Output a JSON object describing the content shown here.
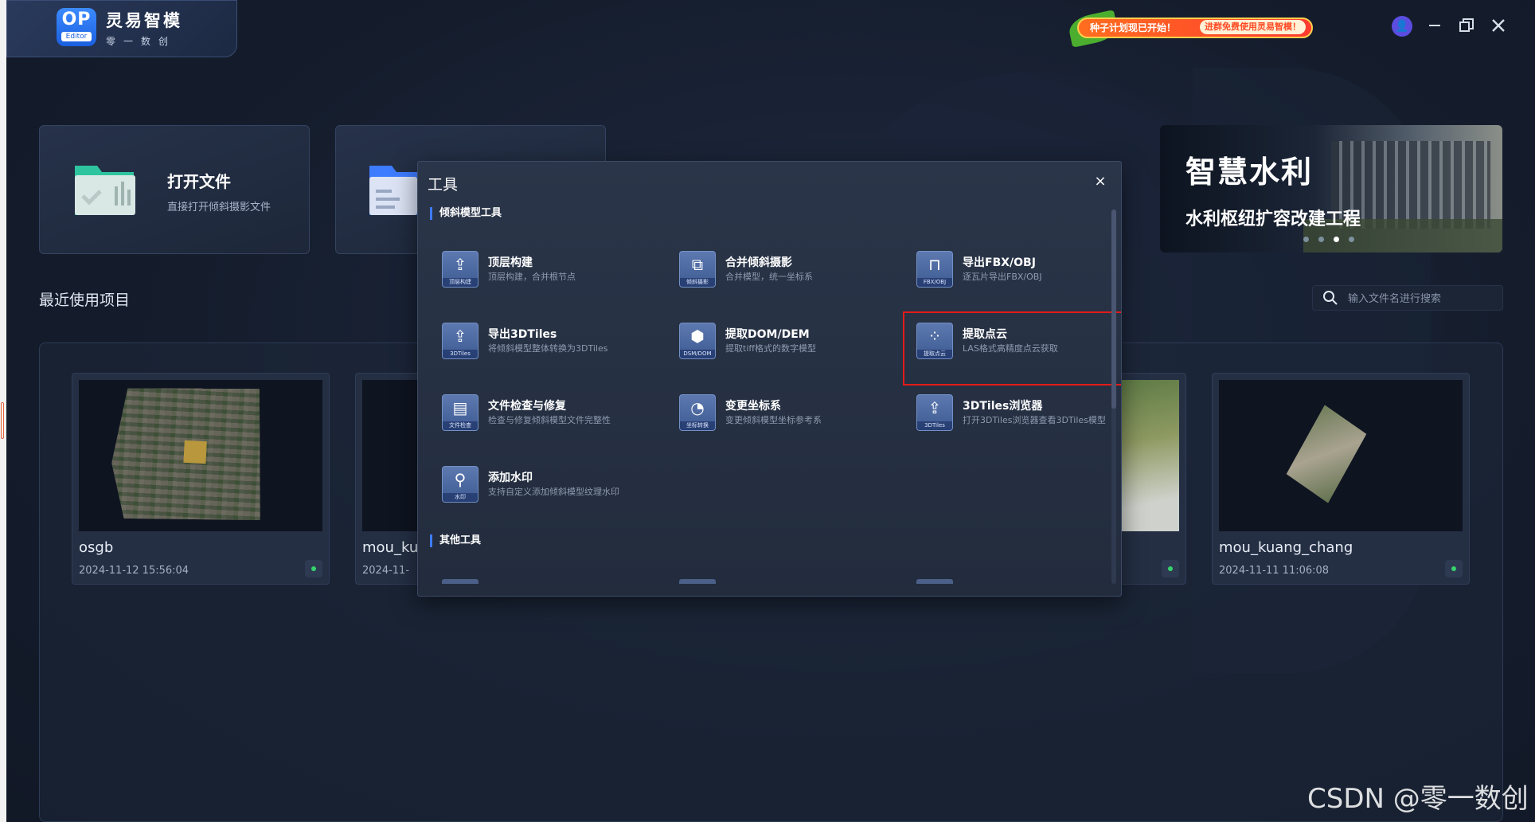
{
  "app": {
    "logo_badge": "OP",
    "logo_badge_sub": "Editor",
    "title": "灵易智模",
    "subtitle": "零一数创"
  },
  "promo": {
    "headline": "种子计划现已开始！",
    "cta": "进群免费使用灵易智模！"
  },
  "window_controls": [
    "user-avatar",
    "minimize",
    "restore",
    "close"
  ],
  "cards": [
    {
      "title": "打开文件",
      "desc": "直接打开倾斜摄影文件",
      "icon": "folder-chart-icon",
      "color": "#2ec4a0"
    },
    {
      "title": "",
      "desc": "",
      "icon": "folder-document-icon",
      "color": "#3d7bff"
    }
  ],
  "banner": {
    "title": "智慧水利",
    "subtitle": "水利枢纽扩容改建工程",
    "slide_count": 4,
    "active_slide": 3
  },
  "recent": {
    "title": "最近使用项目",
    "search_placeholder": "输入文件名进行搜索"
  },
  "projects": [
    {
      "name": "osgb",
      "date": "2024-11-12 15:56:04"
    },
    {
      "name": "mou_ku",
      "date": "2024-11-"
    },
    {
      "name": "",
      "date": ""
    },
    {
      "name": "mou_kuang_chang",
      "date": "2024-11-11 11:06:08"
    }
  ],
  "dialog": {
    "title": "工具",
    "close": "×",
    "section1": "倾斜模型工具",
    "section2": "其他工具",
    "tools": [
      {
        "name": "顶层构建",
        "desc": "顶层构建，合并根节点",
        "cap": "顶层构建",
        "glyph": "⇪"
      },
      {
        "name": "合并倾斜摄影",
        "desc": "合并模型，统一坐标系",
        "cap": "倾斜摄影",
        "glyph": "⧉"
      },
      {
        "name": "导出FBX/OBJ",
        "desc": "逐瓦片导出FBX/OBJ",
        "cap": "FBX/OBJ",
        "glyph": "⊓"
      },
      {
        "name": "导出3DTiles",
        "desc": "将倾斜模型整体转换为3DTiles",
        "cap": "3DTiles",
        "glyph": "⇪"
      },
      {
        "name": "提取DOM/DEM",
        "desc": "提取tiff格式的数字模型",
        "cap": "DSM/DOM",
        "glyph": "⬢"
      },
      {
        "name": "提取点云",
        "desc": "LAS格式高精度点云获取",
        "cap": "提取点云",
        "glyph": "⁘"
      },
      {
        "name": "文件检查与修复",
        "desc": "检查与修复倾斜模型文件完整性",
        "cap": "文件检查",
        "glyph": "▤"
      },
      {
        "name": "变更坐标系",
        "desc": "变更倾斜模型坐标参考系",
        "cap": "坐标转换",
        "glyph": "◔"
      },
      {
        "name": "3DTiles浏览器",
        "desc": "打开3DTiles浏览器查看3DTiles模型",
        "cap": "3DTiles",
        "glyph": "⇪"
      },
      {
        "name": "添加水印",
        "desc": "支持自定义添加倾斜模型纹理水印",
        "cap": "水印",
        "glyph": "⚲"
      }
    ]
  },
  "watermark": "CSDN @零一数创",
  "colors": {
    "accent": "#3d7bff",
    "highlight": "#e21b1b",
    "background": "#151d2d"
  }
}
